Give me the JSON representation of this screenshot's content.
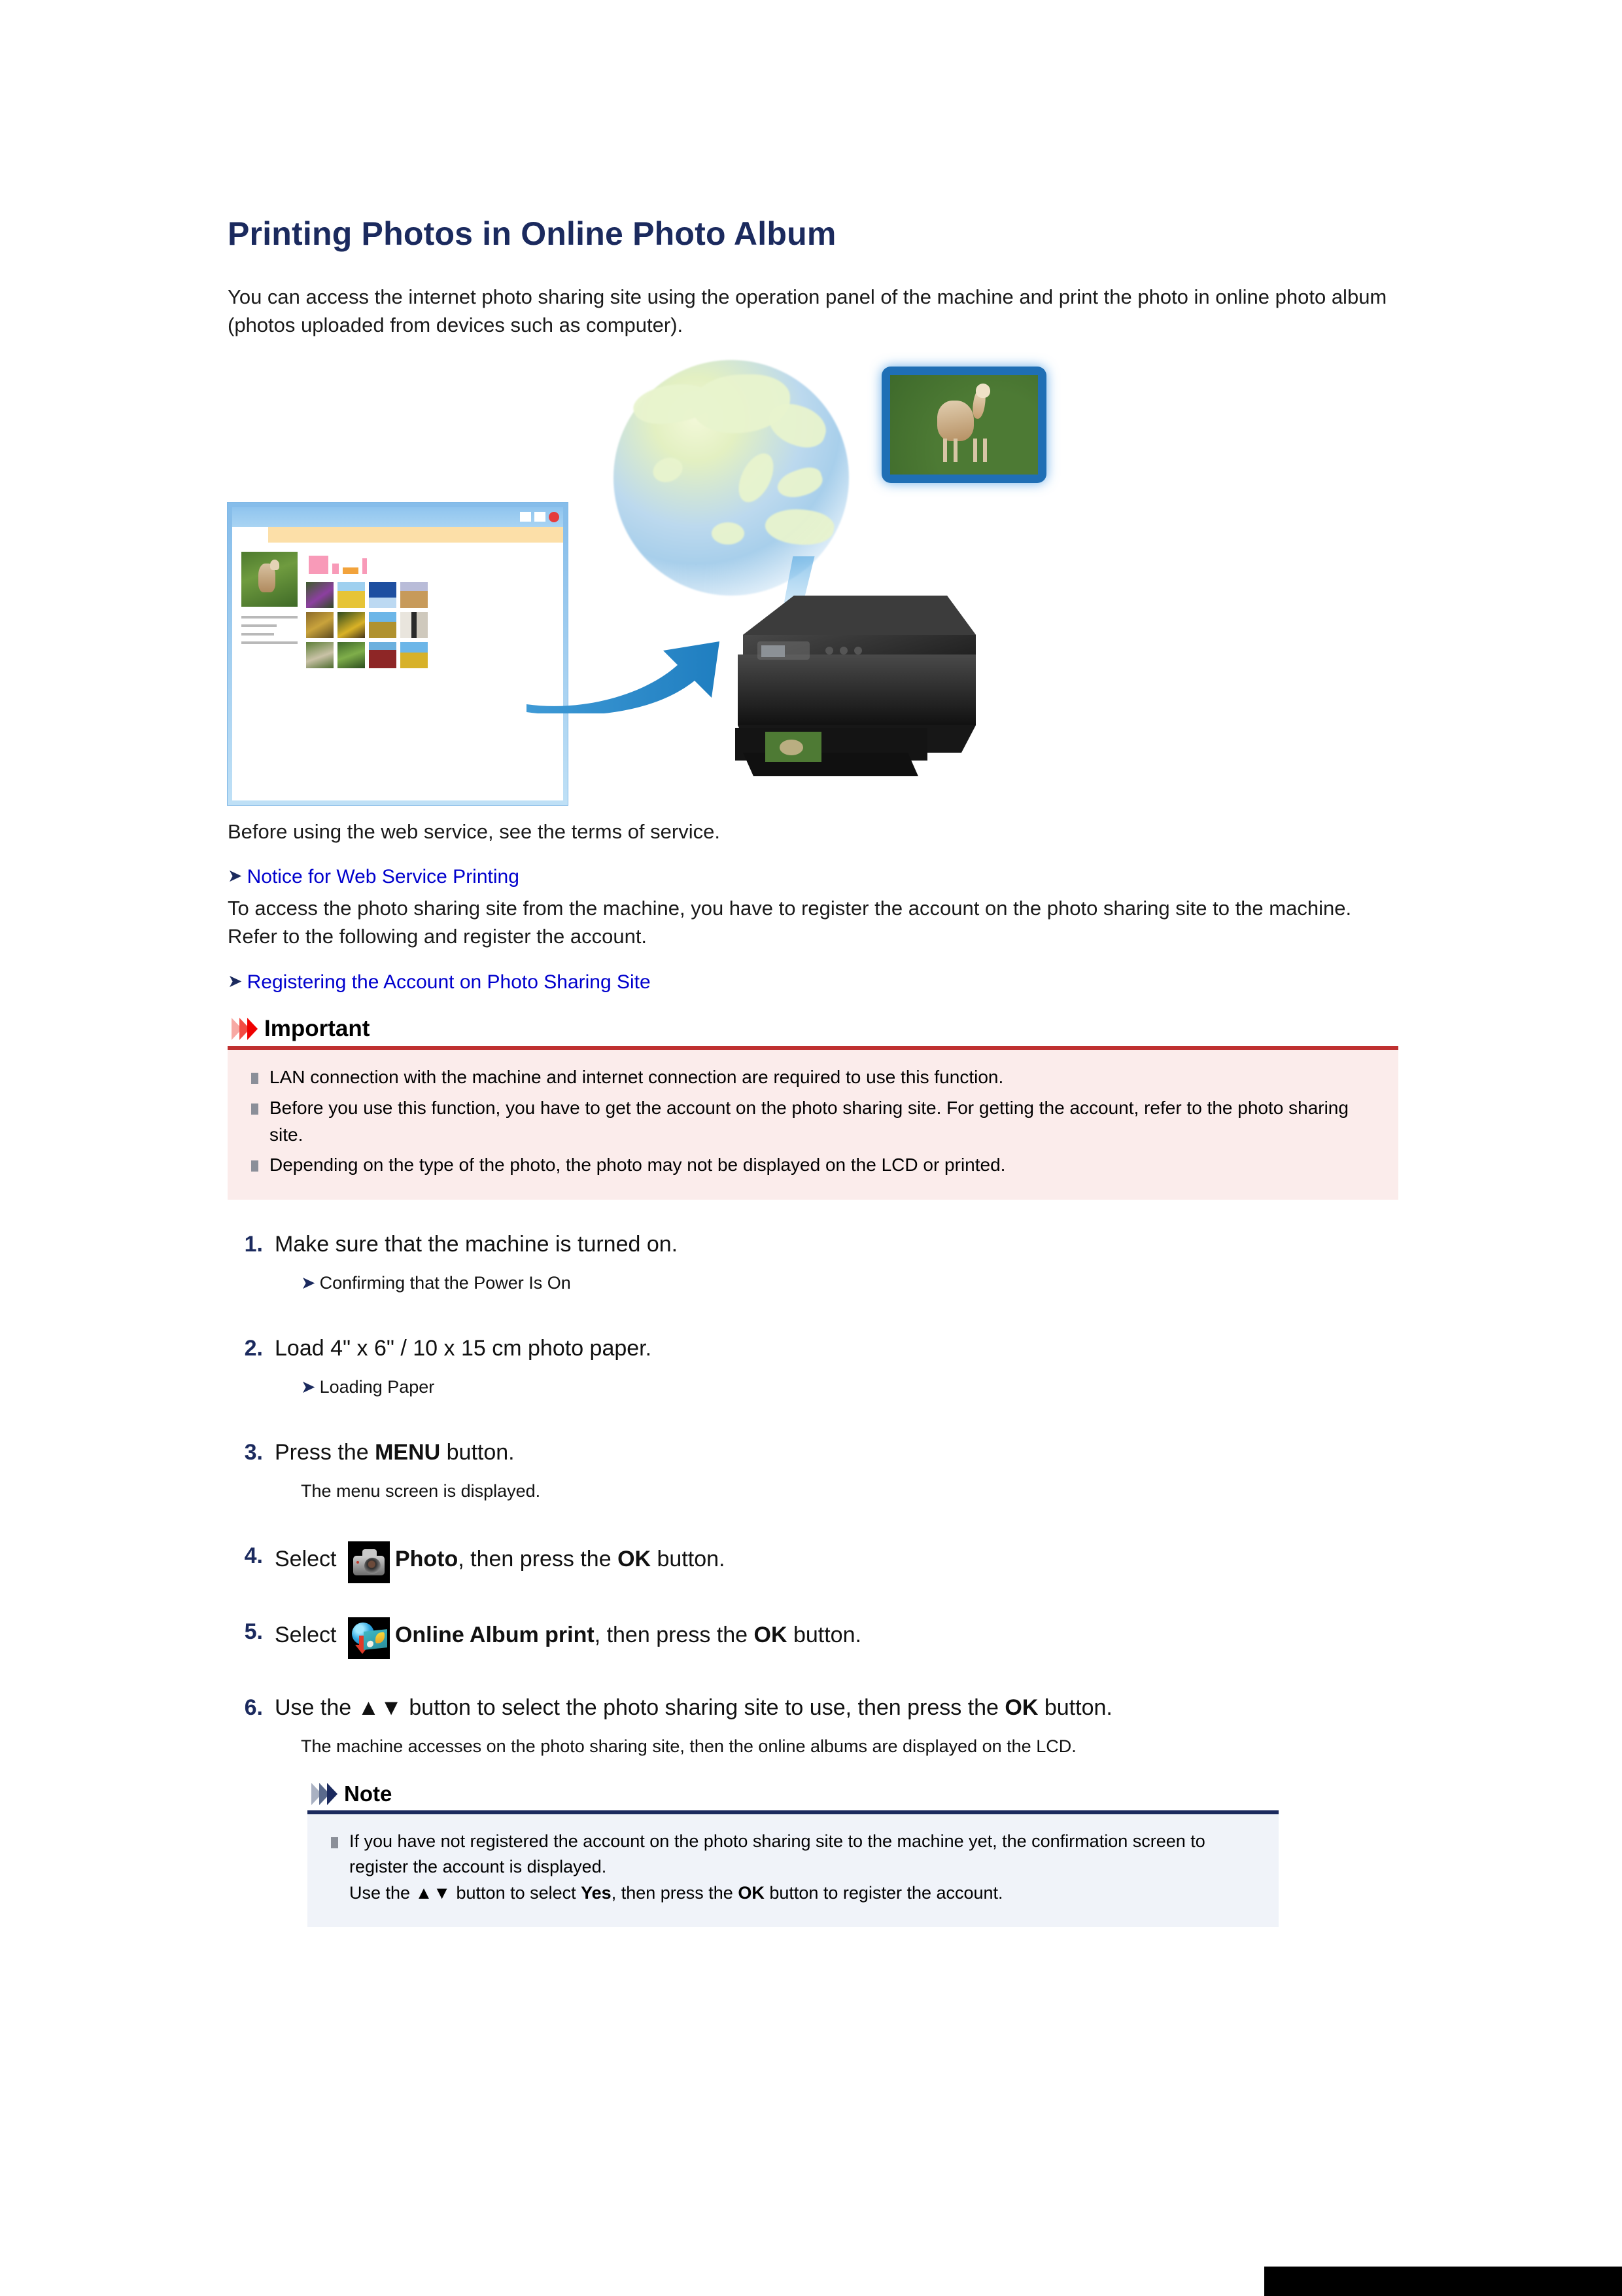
{
  "document": {
    "title": "Printing Photos in Online Photo Album",
    "intro": "You can access the internet photo sharing site using the operation panel of the machine and print the photo in online photo album (photos uploaded from devices such as computer).",
    "terms_note": "Before using the web service, see the terms of service.",
    "link_notice": "Notice for Web Service Printing",
    "register_para": "To access the photo sharing site from the machine, you have to register the account on the photo sharing site to the machine. Refer to the following and register the account.",
    "link_register": "Registering the Account on Photo Sharing Site"
  },
  "figure": {
    "caption_alt": "Online photo album printing illustration",
    "browser_label": "photo-sharing-site-window",
    "globe_label": "internet-globe",
    "printer_label": "multifunction-printer",
    "lcd_label": "printer-lcd-preview"
  },
  "important": {
    "label": "Important",
    "accent_color": "#bf3030",
    "background_color": "#fbeceb",
    "items": [
      "LAN connection with the machine and internet connection are required to use this function.",
      "Before you use this function, you have to get the account on the photo sharing site. For getting the account, refer to the photo sharing site.",
      "Depending on the type of the photo, the photo may not be displayed on the LCD or printed."
    ]
  },
  "note": {
    "label": "Note",
    "accent_color": "#1b2a5e",
    "background_color": "#f0f3f9",
    "item_line1": "If you have not registered the account on the photo sharing site to the machine yet, the confirmation screen to register the account is displayed.",
    "item_line2_pre": "Use the ",
    "item_line2_arrows": "▲▼",
    "item_line2_mid": " button to select ",
    "item_line2_yes": "Yes",
    "item_line2_mid2": ", then press the ",
    "item_line2_ok": "OK",
    "item_line2_end": " button to register the account."
  },
  "steps": [
    {
      "number": "1.",
      "title": "Make sure that the machine is turned on.",
      "sub_link": "Confirming that the Power Is On"
    },
    {
      "number": "2.",
      "title": "Load 4\" x 6\" / 10 x 15 cm photo paper.",
      "sub_link": "Loading Paper"
    },
    {
      "number": "3.",
      "title_pre": "Press the ",
      "title_bold": "MENU",
      "title_post": " button.",
      "sub_text": "The menu screen is displayed."
    },
    {
      "number": "4.",
      "title_pre": "Select ",
      "icon": "camera-icon",
      "title_bold": "Photo",
      "title_mid": ", then press the ",
      "title_bold2": "OK",
      "title_post": " button."
    },
    {
      "number": "5.",
      "title_pre": "Select ",
      "icon": "online-album-icon",
      "title_bold": "Online Album print",
      "title_mid": ", then press the ",
      "title_bold2": "OK",
      "title_post": " button."
    },
    {
      "number": "6.",
      "title_pre": "Use the ",
      "arrows": "▲▼",
      "title_mid": " button to select the photo sharing site to use, then press the ",
      "title_bold2": "OK",
      "title_post": " button.",
      "sub_text": "The machine accesses on the photo sharing site, then the online albums are displayed on the LCD."
    }
  ]
}
